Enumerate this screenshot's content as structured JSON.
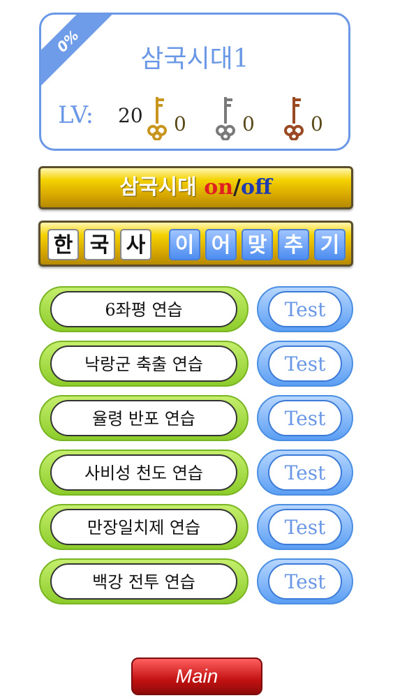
{
  "header": {
    "progress": "0%",
    "title": "삼국시대1",
    "level_label": "LV:",
    "level_value": "20",
    "keys": [
      {
        "name": "gold-key",
        "count": "0",
        "color": "#c8961e"
      },
      {
        "name": "silver-key",
        "count": "0",
        "color": "#7a7a7a"
      },
      {
        "name": "bronze-key",
        "count": "0",
        "color": "#9a4a22"
      }
    ]
  },
  "toggle": {
    "label": "삼국시대 ",
    "on": "on",
    "slash": "/",
    "off": "off"
  },
  "tiles": {
    "white": [
      "한",
      "국",
      "사"
    ],
    "blue": [
      "이",
      "어",
      "맞",
      "추",
      "기"
    ]
  },
  "practice": [
    {
      "label": "6좌평 연습",
      "test": "Test"
    },
    {
      "label": "낙랑군 축출 연습",
      "test": "Test"
    },
    {
      "label": "율령 반포 연습",
      "test": "Test"
    },
    {
      "label": "사비성 천도 연습",
      "test": "Test"
    },
    {
      "label": "만장일치제 연습",
      "test": "Test"
    },
    {
      "label": "백강 전투 연습",
      "test": "Test"
    }
  ],
  "main_button": "Main",
  "colors": {
    "accent_blue": "#6a97e6",
    "gold": "#f4d200",
    "green": "#8ccc2a",
    "red": "#c31212"
  }
}
